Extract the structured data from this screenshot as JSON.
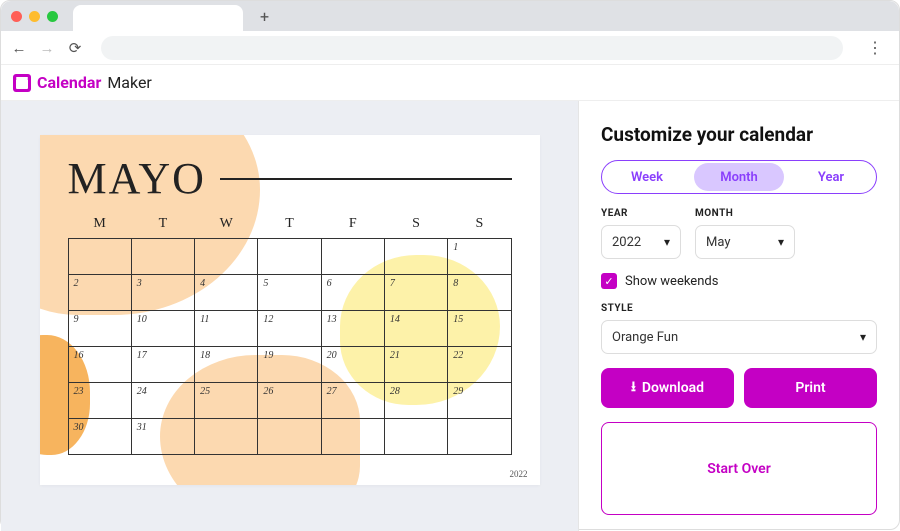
{
  "brand": {
    "part1": "Calendar",
    "part2": "Maker"
  },
  "preview": {
    "month_title": "MAYO",
    "weekdays": [
      "M",
      "T",
      "W",
      "T",
      "F",
      "S",
      "S"
    ],
    "weeks": [
      [
        "",
        "",
        "",
        "",
        "",
        "",
        "1"
      ],
      [
        "2",
        "3",
        "4",
        "5",
        "6",
        "7",
        "8"
      ],
      [
        "9",
        "10",
        "11",
        "12",
        "13",
        "14",
        "15"
      ],
      [
        "16",
        "17",
        "18",
        "19",
        "20",
        "21",
        "22"
      ],
      [
        "23",
        "24",
        "25",
        "26",
        "27",
        "28",
        "29"
      ],
      [
        "30",
        "31",
        "",
        "",
        "",
        "",
        ""
      ]
    ],
    "footer_year": "2022"
  },
  "panel": {
    "title": "Customize your calendar",
    "tabs": {
      "week": "Week",
      "month": "Month",
      "year": "Year",
      "active": "month"
    },
    "year": {
      "label": "YEAR",
      "value": "2022"
    },
    "month": {
      "label": "MONTH",
      "value": "May"
    },
    "show_weekends": {
      "label": "Show weekends",
      "checked": true
    },
    "style": {
      "label": "STYLE",
      "value": "Orange Fun"
    },
    "buttons": {
      "download": "Download",
      "print": "Print",
      "start_over": "Start Over"
    }
  },
  "colors": {
    "accent": "#c400c4",
    "segment": "#8a3ffc"
  }
}
